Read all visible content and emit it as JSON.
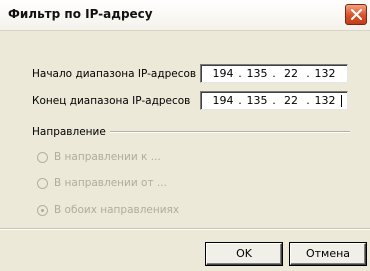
{
  "window": {
    "title": "Фильтр по IP-адресу"
  },
  "range": {
    "start_label": "Начало диапазона IP-адресов",
    "start_ip": [
      "194",
      "135",
      "22",
      "132"
    ],
    "end_label": "Конец диапазона IP-адресов",
    "end_ip": [
      "194",
      "135",
      "22",
      "132"
    ],
    "separator": "."
  },
  "direction": {
    "group_label": "Направление",
    "options": [
      {
        "label": "В направлении к ...",
        "selected": false,
        "enabled": false
      },
      {
        "label": "В направлении от ...",
        "selected": false,
        "enabled": false
      },
      {
        "label": "В обоих направлениях",
        "selected": true,
        "enabled": false
      }
    ]
  },
  "buttons": {
    "ok": "OK",
    "cancel": "Отмена"
  },
  "colors": {
    "dialog_bg": "#ece9d8",
    "close_button": "#d7522a",
    "disabled_text": "#b0ac9c"
  },
  "icons": {
    "close": "close-icon"
  }
}
